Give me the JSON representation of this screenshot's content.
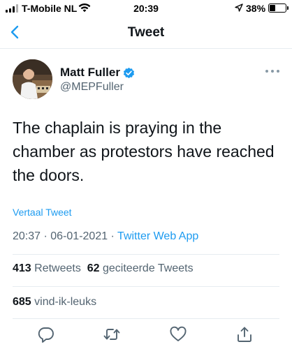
{
  "status_bar": {
    "carrier": "T-Mobile NL",
    "time": "20:39",
    "battery": "38%",
    "battery_level": 0.38
  },
  "nav": {
    "title": "Tweet",
    "back_icon": "chevron-left-icon"
  },
  "tweet": {
    "author_name": "Matt Fuller",
    "author_handle": "@MEPFuller",
    "text": "The chaplain is praying in the chamber as protestors have reached the doors.",
    "translate_label": "Vertaal Tweet",
    "time": "20:37",
    "separator": " · ",
    "date": "06-01-2021",
    "source": "Twitter Web App"
  },
  "stats": {
    "retweets_count": "413",
    "retweets_label": "Retweets",
    "quotes_count": "62",
    "quotes_label": "geciteerde Tweets",
    "likes_count": "685",
    "likes_label": "vind-ik-leuks"
  },
  "actions": [
    "reply-icon",
    "retweet-icon",
    "like-icon",
    "share-icon"
  ],
  "colors": {
    "accent": "#1d9bf0",
    "text": "#0f1419",
    "secondary": "#536471",
    "divider": "#e6ecf0"
  }
}
